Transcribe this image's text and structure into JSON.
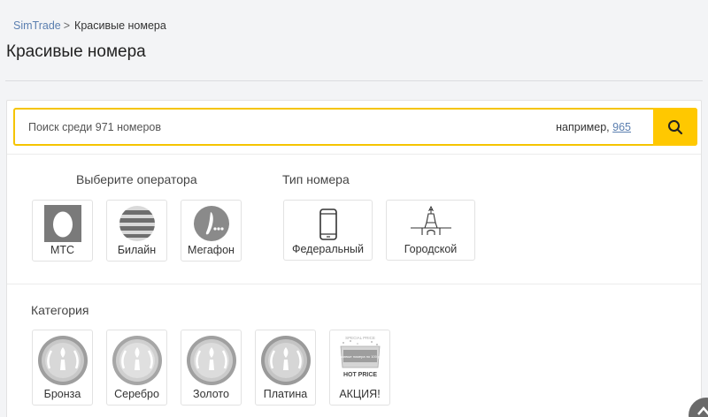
{
  "breadcrumb": {
    "home": "SimTrade",
    "sep": ">",
    "current": "Красивые номера"
  },
  "page_title": "Красивые номера",
  "search": {
    "placeholder": "Поиск среди 971 номеров",
    "hint_prefix": "например,",
    "hint_example": "965",
    "button_icon": "search-icon",
    "accent": "#ffc800"
  },
  "operators": {
    "title": "Выберите оператора",
    "items": [
      {
        "label": "МТС",
        "icon": "mts-egg-icon"
      },
      {
        "label": "Билайн",
        "icon": "beeline-ball-icon"
      },
      {
        "label": "Мегафон",
        "icon": "megafon-icon"
      }
    ]
  },
  "number_type": {
    "title": "Тип номера",
    "items": [
      {
        "label": "Федеральный",
        "icon": "mobile-phone-icon"
      },
      {
        "label": "Городской",
        "icon": "city-tower-icon"
      }
    ]
  },
  "category": {
    "title": "Категория",
    "items": [
      {
        "label": "Бронза",
        "icon": "medal-icon"
      },
      {
        "label": "Серебро",
        "icon": "medal-icon"
      },
      {
        "label": "Золото",
        "icon": "medal-icon"
      },
      {
        "label": "Платина",
        "icon": "medal-icon"
      },
      {
        "label": "АКЦИЯ!",
        "icon": "hot-price-icon",
        "badge_top": "SPECIAL PRICE",
        "badge_mid": "Красивые номера по 100 руб.",
        "badge_bottom": "HOT PRICE"
      }
    ]
  }
}
